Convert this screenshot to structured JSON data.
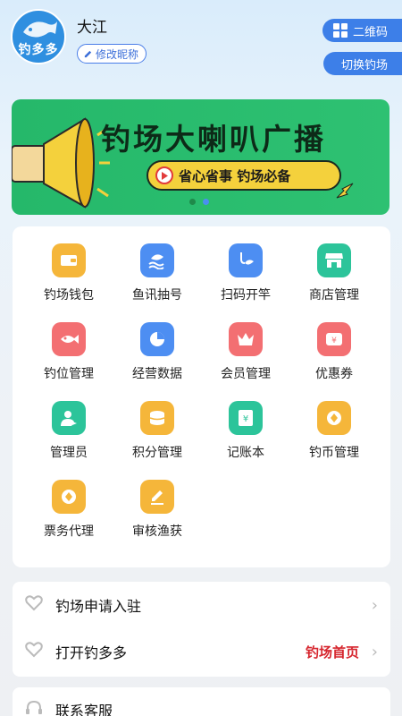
{
  "header": {
    "avatar_text": "钓多多",
    "username": "大江",
    "edit_nickname": "修改昵称",
    "qr_label": "二维码",
    "switch_label": "切换钓场"
  },
  "banner": {
    "title": "钓场大喇叭广播",
    "subtitle": "省心省事  钓场必备",
    "colors": {
      "bg": "#2ec172",
      "badge": "#f4d13c"
    }
  },
  "grid": [
    {
      "label": "钓场钱包",
      "icon": "wallet-icon",
      "color": "#f5b63a"
    },
    {
      "label": "鱼讯抽号",
      "icon": "fish-wave-icon",
      "color": "#4d8ef2"
    },
    {
      "label": "扫码开竿",
      "icon": "fishing-hook-icon",
      "color": "#4d8ef2"
    },
    {
      "label": "商店管理",
      "icon": "store-icon",
      "color": "#2cc49a"
    },
    {
      "label": "钓位管理",
      "icon": "fish-icon",
      "color": "#f36f72"
    },
    {
      "label": "经营数据",
      "icon": "pie-chart-icon",
      "color": "#4d8ef2"
    },
    {
      "label": "会员管理",
      "icon": "crown-icon",
      "color": "#f36f72"
    },
    {
      "label": "优惠券",
      "icon": "coupon-icon",
      "color": "#f36f72"
    },
    {
      "label": "管理员",
      "icon": "user-admin-icon",
      "color": "#2cc49a"
    },
    {
      "label": "积分管理",
      "icon": "coins-stack-icon",
      "color": "#f5b63a"
    },
    {
      "label": "记账本",
      "icon": "ledger-icon",
      "color": "#2cc49a"
    },
    {
      "label": "钓币管理",
      "icon": "coin-icon",
      "color": "#f5b63a"
    },
    {
      "label": "票务代理",
      "icon": "ticket-icon",
      "color": "#f5b63a"
    },
    {
      "label": "审核渔获",
      "icon": "edit-icon",
      "color": "#f5b63a"
    }
  ],
  "list": {
    "apply": "钓场申请入驻",
    "open_app": "打开钓多多",
    "home_link": "钓场首页",
    "contact": "联系客服"
  }
}
